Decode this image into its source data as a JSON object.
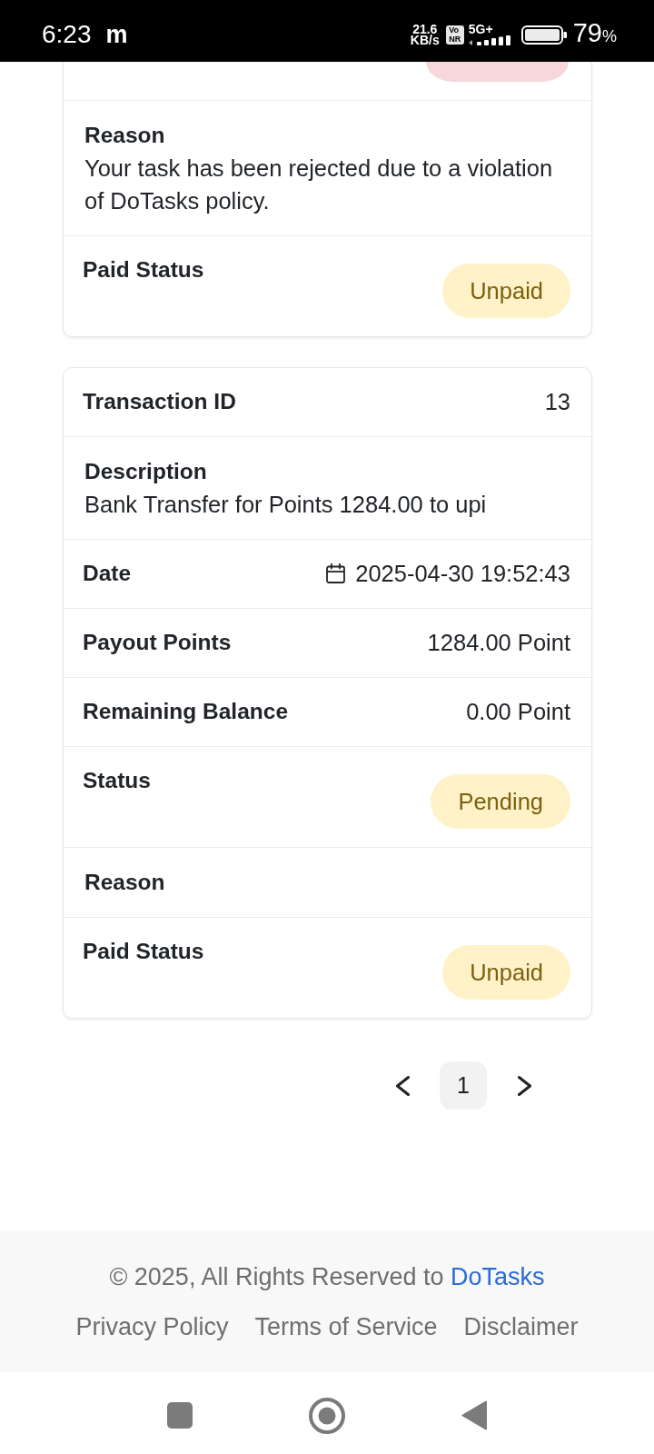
{
  "status_bar": {
    "time": "6:23",
    "notification": "m",
    "speed_value": "21.6",
    "speed_unit": "KB/s",
    "network_badge": [
      "Vo",
      "NR"
    ],
    "network_type": "5G+",
    "battery_value": "79",
    "battery_unit": "%"
  },
  "cards": [
    {
      "rows": [
        {
          "kind": "clipped_badge",
          "color": "#f8d7da"
        },
        {
          "kind": "block",
          "label": "Reason",
          "text": "Your task has been rejected due to a violation of DoTasks policy."
        },
        {
          "kind": "badge",
          "label": "Paid Status",
          "value": "Unpaid",
          "color": "#fff2c8"
        }
      ]
    },
    {
      "rows": [
        {
          "kind": "pair",
          "label": "Transaction ID",
          "value": "13"
        },
        {
          "kind": "block",
          "label": "Description",
          "text": "Bank Transfer for Points 1284.00 to upi"
        },
        {
          "kind": "date",
          "label": "Date",
          "value": "2025-04-30 19:52:43"
        },
        {
          "kind": "pair",
          "label": "Payout Points",
          "value": "1284.00 Point"
        },
        {
          "kind": "pair",
          "label": "Remaining Balance",
          "value": "0.00 Point"
        },
        {
          "kind": "badge",
          "label": "Status",
          "value": "Pending",
          "color": "#fff2c8"
        },
        {
          "kind": "block",
          "label": "Reason"
        },
        {
          "kind": "badge",
          "label": "Paid Status",
          "value": "Unpaid",
          "color": "#fff2c8"
        }
      ]
    }
  ],
  "pagination": {
    "pages": [
      {
        "label": "1",
        "selected": true
      }
    ]
  },
  "footer": {
    "copyright": "© 2025, All Rights Reserved to",
    "brand_link": "DoTasks",
    "links": [
      "Privacy Policy",
      "Terms of Service",
      "Disclaimer"
    ]
  }
}
